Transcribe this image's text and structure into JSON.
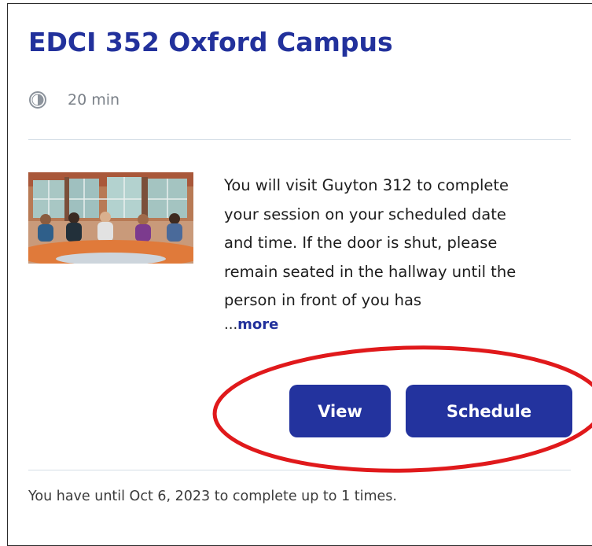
{
  "card": {
    "title": "EDCI 352 Oxford Campus",
    "duration": {
      "icon": "clock-icon",
      "text": "20 min"
    },
    "thumbnail": {
      "alt": "virtual classroom scene"
    },
    "description": "You will visit Guyton 312 to complete\nyour session on your scheduled date\nand time. If the door is shut, please\nremain seated in the hallway until the\nperson in front of you has",
    "more_link": {
      "prefix": "...",
      "label": "more"
    },
    "buttons": {
      "view_label": "View",
      "schedule_label": "Schedule"
    },
    "footer": "You have until Oct 6, 2023 to complete up to 1 times."
  },
  "colors": {
    "brand": "#23339e",
    "title": "#22319c",
    "annotation": "#e0191b"
  }
}
